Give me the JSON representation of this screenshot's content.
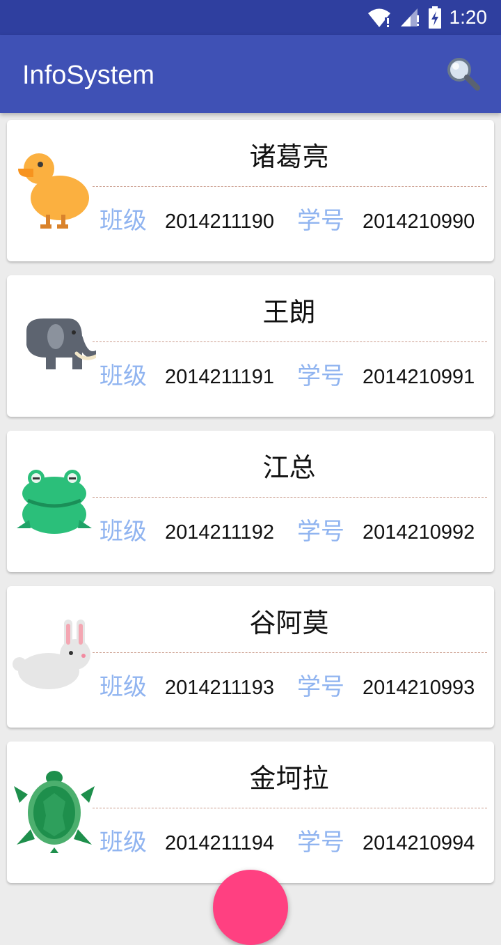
{
  "status_bar": {
    "time": "1:20",
    "icons": [
      "wifi-icon",
      "signal-icon",
      "battery-charging-icon"
    ]
  },
  "app_bar": {
    "title": "InfoSystem",
    "search_icon": "search-icon"
  },
  "labels": {
    "class": "班级",
    "student_id": "学号"
  },
  "students": [
    {
      "name": "诸葛亮",
      "class": "2014211190",
      "student_id": "2014210990",
      "avatar": "duck-icon"
    },
    {
      "name": "王朗",
      "class": "2014211191",
      "student_id": "2014210991",
      "avatar": "elephant-icon"
    },
    {
      "name": "江总",
      "class": "2014211192",
      "student_id": "2014210992",
      "avatar": "frog-icon"
    },
    {
      "name": "谷阿莫",
      "class": "2014211193",
      "student_id": "2014210993",
      "avatar": "rabbit-icon"
    },
    {
      "name": "金坷拉",
      "class": "2014211194",
      "student_id": "2014210994",
      "avatar": "turtle-icon"
    }
  ],
  "colors": {
    "primary": "#3f51b5",
    "primary_dark": "#2f3f9f",
    "accent": "#ff4081",
    "label": "#90b4f0"
  }
}
